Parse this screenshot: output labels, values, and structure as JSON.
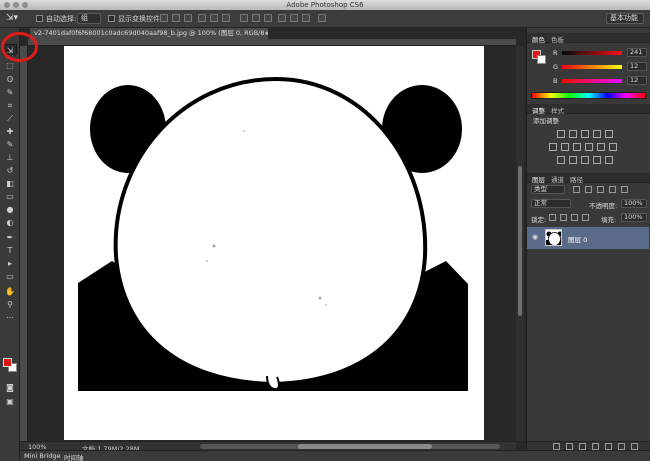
{
  "window": {
    "title": "Adobe Photoshop CS6"
  },
  "options_bar": {
    "auto_select_label": "自动选择:",
    "auto_select_value": "组",
    "show_transform_label": "显示变换控件",
    "workspace": "基本功能"
  },
  "document": {
    "tab_title": "v2-7401daf0f6f68001c0adc69d040aaf98_b.jpg @ 100% (图层 0, RGB/8#) *"
  },
  "status_bar": {
    "zoom": "100%",
    "doc_size": "文档:1.79M/2.28M"
  },
  "bottom_tabs": [
    "Mini Bridge",
    "时间轴"
  ],
  "color_panel": {
    "tabs": [
      "颜色",
      "色板"
    ],
    "channels": [
      {
        "label": "R",
        "value": "241"
      },
      {
        "label": "G",
        "value": "12"
      },
      {
        "label": "B",
        "value": "12"
      }
    ],
    "foreground": "#f10c0c"
  },
  "adjustments_panel": {
    "tabs": [
      "调整",
      "样式"
    ],
    "title": "添加调整"
  },
  "layers_panel": {
    "tabs": [
      "图层",
      "通道",
      "路径"
    ],
    "filter_type": "类型",
    "blend_mode": "正常",
    "opacity_label": "不透明度:",
    "opacity_value": "100%",
    "lock_label": "锁定:",
    "fill_label": "填充:",
    "fill_value": "100%",
    "layers": [
      {
        "name": "图层 0"
      }
    ]
  },
  "colors": {
    "annotation": "#e21a1a",
    "selected_layer": "#5a6b8a"
  }
}
